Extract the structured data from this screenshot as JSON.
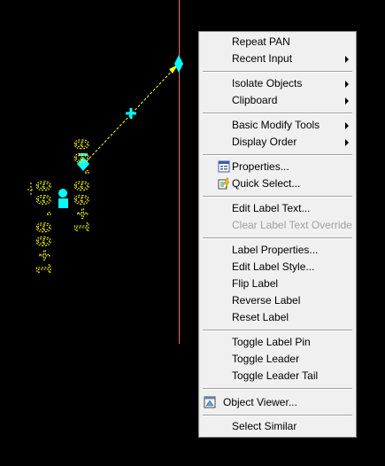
{
  "canvas": {
    "label_left": "1+00.00",
    "label_right": "1+00.00",
    "colors": {
      "background": "#000000",
      "alignment_line": "#ff6b6b",
      "label_text": "#ffff00",
      "grip": "#00ffff",
      "leader": "#ffff00"
    }
  },
  "menu": {
    "items": [
      {
        "label": "Repeat PAN",
        "submenu": false,
        "disabled": false,
        "icon": ""
      },
      {
        "label": "Recent Input",
        "submenu": true,
        "disabled": false,
        "icon": ""
      },
      {
        "label": "Isolate Objects",
        "submenu": true,
        "disabled": false,
        "icon": ""
      },
      {
        "label": "Clipboard",
        "submenu": true,
        "disabled": false,
        "icon": ""
      },
      {
        "label": "Basic Modify Tools",
        "submenu": true,
        "disabled": false,
        "icon": ""
      },
      {
        "label": "Display Order",
        "submenu": true,
        "disabled": false,
        "icon": ""
      },
      {
        "label": "Properties...",
        "submenu": false,
        "disabled": false,
        "icon": "properties-icon"
      },
      {
        "label": "Quick Select...",
        "submenu": false,
        "disabled": false,
        "icon": "quick-select-icon"
      },
      {
        "label": "Edit Label Text...",
        "submenu": false,
        "disabled": false,
        "icon": ""
      },
      {
        "label": "Clear Label Text Override",
        "submenu": false,
        "disabled": true,
        "icon": ""
      },
      {
        "label": "Label Properties...",
        "submenu": false,
        "disabled": false,
        "icon": ""
      },
      {
        "label": "Edit Label Style...",
        "submenu": false,
        "disabled": false,
        "icon": ""
      },
      {
        "label": "Flip Label",
        "submenu": false,
        "disabled": false,
        "icon": ""
      },
      {
        "label": "Reverse Label",
        "submenu": false,
        "disabled": false,
        "icon": ""
      },
      {
        "label": "Reset Label",
        "submenu": false,
        "disabled": false,
        "icon": ""
      },
      {
        "label": "Toggle Label Pin",
        "submenu": false,
        "disabled": false,
        "icon": ""
      },
      {
        "label": "Toggle Leader",
        "submenu": false,
        "disabled": false,
        "icon": ""
      },
      {
        "label": "Toggle Leader Tail",
        "submenu": false,
        "disabled": false,
        "icon": ""
      },
      {
        "label": "Object Viewer...",
        "submenu": false,
        "disabled": false,
        "icon": "object-viewer-icon"
      },
      {
        "label": "Select Similar",
        "submenu": false,
        "disabled": false,
        "icon": ""
      }
    ]
  }
}
